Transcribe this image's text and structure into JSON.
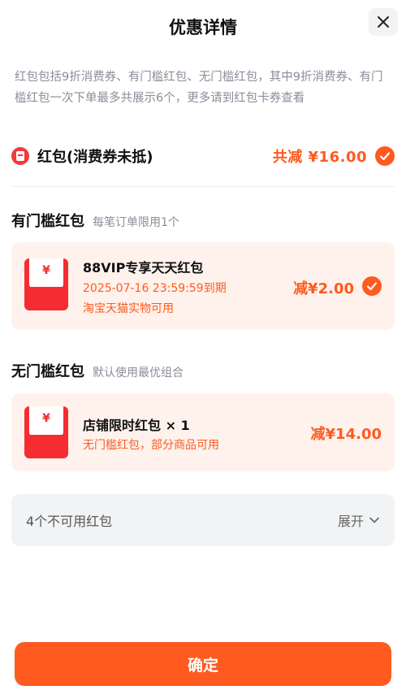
{
  "header": {
    "title": "优惠详情"
  },
  "description": "红包包括9折消费券、有门槛红包、无门槛红包，其中9折消费券、有门槛红包一次下单最多共展示6个，更多请到红包卡券查看",
  "summary": {
    "label": "红包(消费券未抵)",
    "total": "共减 ¥16.00"
  },
  "threshold_section": {
    "title": "有门槛红包",
    "subtitle": "每笔订单限用1个",
    "card": {
      "name": "88VIP专享天天红包",
      "expiry": "2025-07-16 23:59:59到期",
      "scope": "淘宝天猫实物可用",
      "discount": "减¥2.00"
    }
  },
  "no_threshold_section": {
    "title": "无门槛红包",
    "subtitle": "默认使用最优组合",
    "card": {
      "name": "店铺限时红包 × 1",
      "scope": "无门槛红包，部分商品可用",
      "discount": "减¥14.00"
    }
  },
  "unavailable": {
    "label": "4个不可用红包",
    "expand": "展开"
  },
  "footer": {
    "confirm": "确定"
  },
  "icons": {
    "yen_glyph": "¥",
    "accent": "#ff5a1f",
    "envelope_red": "#f52d33"
  }
}
